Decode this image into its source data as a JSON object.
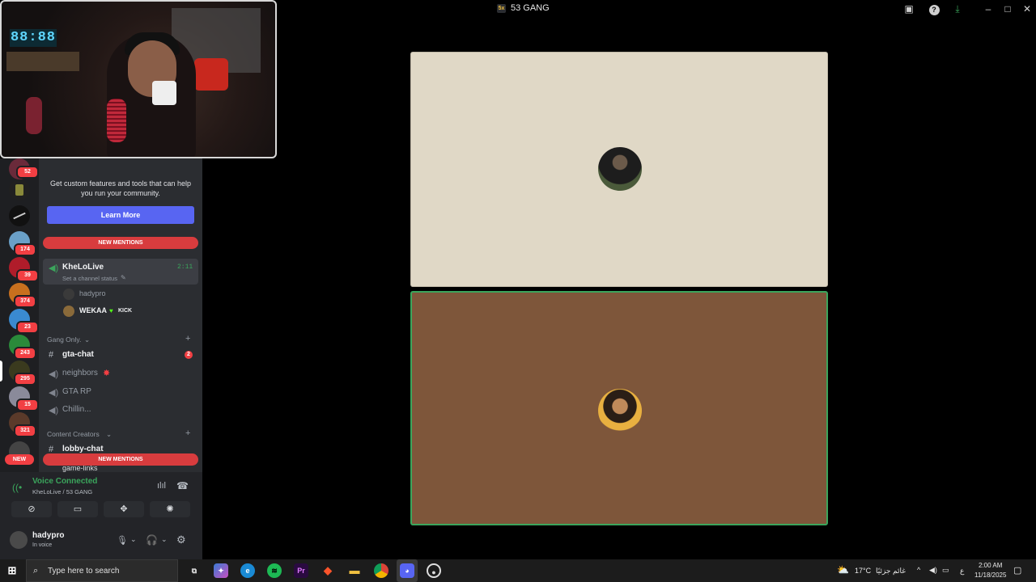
{
  "window": {
    "title": "53 GANG",
    "logo": "5x"
  },
  "webcam": {
    "clock": "88:88"
  },
  "rail": {
    "badges": [
      "52",
      "174",
      "39",
      "374",
      "23",
      "243",
      "295",
      "15",
      "321"
    ],
    "new_label": "NEW"
  },
  "promo": {
    "text": "Get custom features and tools that can help you run your community.",
    "button": "Learn More"
  },
  "mentions": {
    "top": "NEW MENTIONS",
    "bottom": "NEW MENTIONS"
  },
  "voice_channel": {
    "name": "KheLoLive",
    "timer": "2:11",
    "status": "Set a channel status",
    "members": [
      {
        "name": "hadypro"
      },
      {
        "name": "WEKAA",
        "tag": "KICK"
      }
    ]
  },
  "categories": [
    {
      "title": "Gang Only.",
      "channels": [
        {
          "name": "gta-chat",
          "type": "text",
          "badge": "2"
        },
        {
          "name": "neighbors",
          "type": "voice"
        },
        {
          "name": "GTA RP",
          "type": "voice"
        },
        {
          "name": "Chillin...",
          "type": "voice"
        }
      ]
    },
    {
      "title": "Content Creators",
      "channels": [
        {
          "name": "lobby-chat",
          "type": "text"
        },
        {
          "name": "game-links",
          "type": "text"
        }
      ]
    }
  ],
  "voice_panel": {
    "status": "Voice Connected",
    "location": "KheLoLive / 53 GANG"
  },
  "user": {
    "name": "hadypro",
    "status": "In voice"
  },
  "stage": {
    "tile1_color": "#e0d8c6",
    "tile2_color": "#7e563a",
    "speaking_border": "#3ba55c"
  },
  "taskbar": {
    "search_placeholder": "Type here to search",
    "weather": "17°C",
    "weather_label": "غائم جزئيًا",
    "lang": "ع",
    "time": "2:00 AM",
    "date": "11/18/2025"
  }
}
